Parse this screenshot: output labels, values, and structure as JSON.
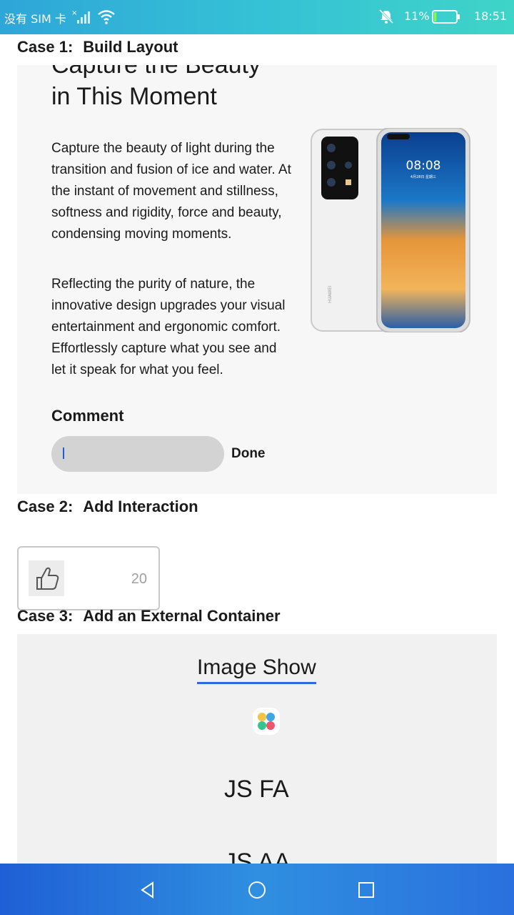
{
  "status_bar": {
    "carrier": "没有 SIM 卡",
    "battery_percent": "11%",
    "battery_level": 0.11,
    "time": "18:51",
    "icons": [
      "signal-icon",
      "wifi-icon",
      "bell-muted-icon",
      "battery-icon"
    ]
  },
  "case1": {
    "title_prefix": "Case 1:",
    "title": "Build Layout",
    "heading_line1": "Capture the Beauty",
    "heading_line2": "in This Moment",
    "paragraph1": "Capture the beauty of light during the transition and fusion of ice and water. At the instant of movement and stillness, softness and rigidity, force and beauty, condensing moving moments.",
    "paragraph2": "Reflecting the purity of nature, the innovative design upgrades your visual entertainment and ergonomic comfort. Effortlessly capture what you see and let it speak for what you feel.",
    "comment_label": "Comment",
    "comment_value": "",
    "done_label": "Done",
    "phone_screen_time": "08:08",
    "phone_screen_date": "4月28日 星期三",
    "phone_brand": "HUAWEI"
  },
  "case2": {
    "title_prefix": "Case 2:",
    "title": "Add Interaction",
    "like_count": "20"
  },
  "case3": {
    "title_prefix": "Case 3:",
    "title": "Add an External Container",
    "tab_label": "Image Show",
    "item1": "JS FA",
    "item2": "JS AA"
  },
  "nav_bar": {
    "buttons": [
      "back-icon",
      "home-icon",
      "recents-icon"
    ]
  },
  "colors": {
    "status_bar": "#35c1d6",
    "nav_bar": "#2a70de",
    "accent": "#2a6ae9",
    "input_bg": "#d3d3d3"
  }
}
